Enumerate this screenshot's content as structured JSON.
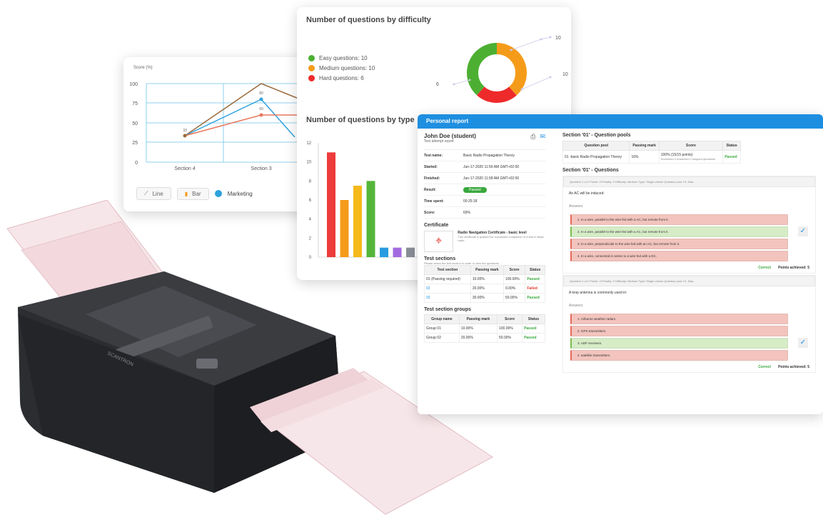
{
  "line_chart": {
    "y_label": "Score (%)",
    "y_ticks": [
      "100",
      "75",
      "50",
      "25",
      "0"
    ],
    "x_ticks": [
      "Section 4",
      "Section 3"
    ],
    "point_labels": [
      "33",
      "80",
      "60"
    ],
    "legend": {
      "line": "Line",
      "bar": "Bar",
      "series": "Marketing"
    },
    "colors": {
      "brown": "#9b6a3c",
      "blue": "#2ea1dc",
      "red": "#e8775c"
    }
  },
  "difficulty": {
    "title": "Number of questions by difficulty",
    "items": [
      {
        "label": "Easy questions: 10",
        "color": "#4caf32"
      },
      {
        "label": "Medium questions: 10",
        "color": "#f59b1a"
      },
      {
        "label": "Hard questions: 6",
        "color": "#ee2a2a"
      }
    ],
    "donut_labels": [
      "10",
      "10",
      "6"
    ]
  },
  "type_chart": {
    "title": "Number of questions by type",
    "y_ticks": [
      "12",
      "10",
      "8",
      "6",
      "4",
      "2",
      "0"
    ]
  },
  "chart_data": [
    {
      "type": "line",
      "ylabel": "Score (%)",
      "categories": [
        "Section 4",
        "Section 3"
      ],
      "ylim": [
        0,
        100
      ]
    },
    {
      "type": "pie",
      "title": "Number of questions by difficulty",
      "categories": [
        "Easy questions",
        "Medium questions",
        "Hard questions"
      ],
      "values": [
        10,
        10,
        6
      ]
    },
    {
      "type": "bar",
      "title": "Number of questions by type",
      "values": [
        11,
        6,
        7.5,
        8,
        1,
        1,
        1
      ],
      "colors": [
        "#ee3b3b",
        "#f59b1a",
        "#f5b919",
        "#55b53a",
        "#2a9be0",
        "#a36ae0",
        "#8a8f98"
      ],
      "ylim": [
        0,
        12
      ]
    }
  ],
  "report": {
    "header": "Personal report",
    "student": "John Doe (student)",
    "subtitle": "Test attempt report",
    "fields": [
      {
        "k": "Test name:",
        "v": "Basic Radio Propagation Theory"
      },
      {
        "k": "Started:",
        "v": "Jun-17-2020 11:56 AM GMT+02:00"
      },
      {
        "k": "Finished:",
        "v": "Jun-17-2020 11:58 AM GMT+02:00"
      },
      {
        "k": "Time spent:",
        "v": "00:25:18"
      },
      {
        "k": "Score:",
        "v": "69%"
      }
    ],
    "result_label": "Result:",
    "result_value": "Passed",
    "certificate_title": "Certificate",
    "certificate_name": "Radio Navigation Certificate - basic level",
    "certificate_desc": "This certificate is granted for successful completion of a test in Basic radio...",
    "sections_title": "Test sections",
    "sections_hint": "Please select the test section in order to view the questions",
    "sections_headers": [
      "Test section",
      "Passing mark",
      "Score",
      "Status"
    ],
    "sections_rows": [
      [
        "01 (Passing required)",
        "10.00%",
        "100.00%",
        "Passed"
      ],
      [
        "02",
        "20.00%",
        "0.00%",
        "Failed"
      ],
      [
        "03",
        "30.00%",
        "50.00%",
        "Passed"
      ]
    ],
    "groups_title": "Test section groups",
    "groups_headers": [
      "Group name",
      "Passing mark",
      "Score",
      "Status"
    ],
    "groups_rows": [
      [
        "Group 01",
        "10.00%",
        "100.00%",
        "Passed"
      ],
      [
        "Group 02",
        "20.00%",
        "50.00%",
        "Passed"
      ]
    ],
    "pools_title": "Section '01' - Question pools",
    "pools_headers": [
      "Question pool",
      "Passing mark",
      "Score",
      "Status"
    ],
    "pools_row": [
      "01 -basic Radio Propagation Theory",
      "16%",
      "100% (15/15 points)",
      "Passed"
    ],
    "pools_note": "Examined 2 Answered 2 skipped questions",
    "questions_title": "Section '01' - Questions",
    "q1_head": "Question 1 of 2     Points: 5     Penalty: 0     Difficulty: Medium     Type: Single-choice     Question pool: 01 -Bas...",
    "q1_text": "An AC will be induced:",
    "q1_answers_label": "Answers:",
    "q1_answers": [
      "1.    In a wire, parallel to the wire fed with a AC, but remote from it.",
      "2.    In a wire, parallel to the wire fed with a AC, but remote from it.",
      "3.    In a wire, perpendicular to the wire fed with an AC, but remote from it.",
      "4.    In a wire, connected in series to a wire fed with a DC."
    ],
    "q2_head": "Question 2 of 2     Points: 5     Penalty: 0     Difficulty: Medium     Type: Single-choice     Question pool: 01 -Bas...",
    "q2_text": "A loop antenna is commonly used in:",
    "q2_answers_label": "Answers:",
    "q2_answers": [
      "1.    Airborne weather radars.",
      "2.    GPS transmitters.",
      "3.    ADF receivers.",
      "4.    satellite transmitters."
    ],
    "correct_label": "Correct",
    "points_label": "Points achieved: 5",
    "check_glyph": "✓"
  },
  "scanner": {
    "brand": "SCANTRON"
  }
}
